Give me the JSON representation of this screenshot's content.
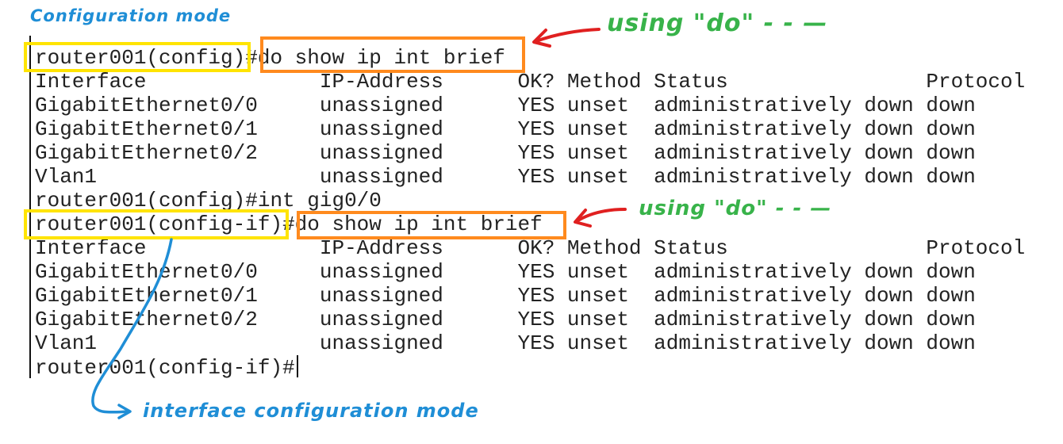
{
  "annotations": {
    "config_mode_label": "Configuration mode",
    "using_do_top": "using \"do\" - - —",
    "using_do_bottom": "using \"do\" - - —",
    "interface_config_mode_label": "interface configuration mode"
  },
  "terminal": {
    "block1": {
      "prompt": "router001(config)",
      "command_prefix": "#",
      "command": "do show ip int brief",
      "header": "Interface              IP-Address      OK? Method Status                Protocol",
      "rows": [
        "GigabitEthernet0/0     unassigned      YES unset  administratively down down",
        "GigabitEthernet0/1     unassigned      YES unset  administratively down down",
        "GigabitEthernet0/2     unassigned      YES unset  administratively down down",
        "Vlan1                  unassigned      YES unset  administratively down down"
      ]
    },
    "between_line": "router001(config)#int gig0/0",
    "block2": {
      "prompt": "router001(config-if)",
      "command_prefix": "#",
      "command": "do show ip int brief",
      "header": "Interface              IP-Address      OK? Method Status                Protocol",
      "rows": [
        "GigabitEthernet0/0     unassigned      YES unset  administratively down down",
        "GigabitEthernet0/1     unassigned      YES unset  administratively down down",
        "GigabitEthernet0/2     unassigned      YES unset  administratively down down",
        "Vlan1                  unassigned      YES unset  administratively down down"
      ]
    },
    "final_prompt": "router001(config-if)#"
  },
  "colors": {
    "highlight_yellow": "#ffe400",
    "highlight_orange": "#ff8a1e",
    "annotation_blue": "#1f8ed6",
    "annotation_green": "#38b34a",
    "annotation_red": "#e02020"
  }
}
